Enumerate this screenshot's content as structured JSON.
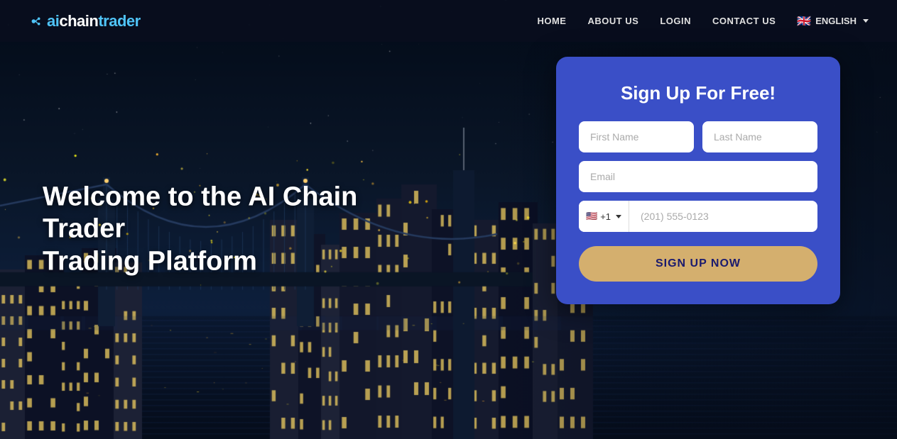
{
  "nav": {
    "logo": {
      "text_ai": "ai",
      "text_chain": "chain",
      "text_trader": "trader"
    },
    "links": [
      {
        "label": "HOME",
        "id": "home"
      },
      {
        "label": "ABOUT US",
        "id": "about"
      },
      {
        "label": "LOGIN",
        "id": "login"
      },
      {
        "label": "CONTACT US",
        "id": "contact"
      }
    ],
    "language": {
      "flag": "🇬🇧",
      "label": "ENGLISH"
    }
  },
  "hero": {
    "title_line1": "Welcome to the AI Chain Trader",
    "title_line2": "Trading Platform"
  },
  "signup": {
    "title": "Sign Up For Free!",
    "first_name_placeholder": "First Name",
    "last_name_placeholder": "Last Name",
    "email_placeholder": "Email",
    "phone_country_code": "+1",
    "phone_placeholder": "(201) 555-0123",
    "button_label": "SIGN UP NOW"
  }
}
